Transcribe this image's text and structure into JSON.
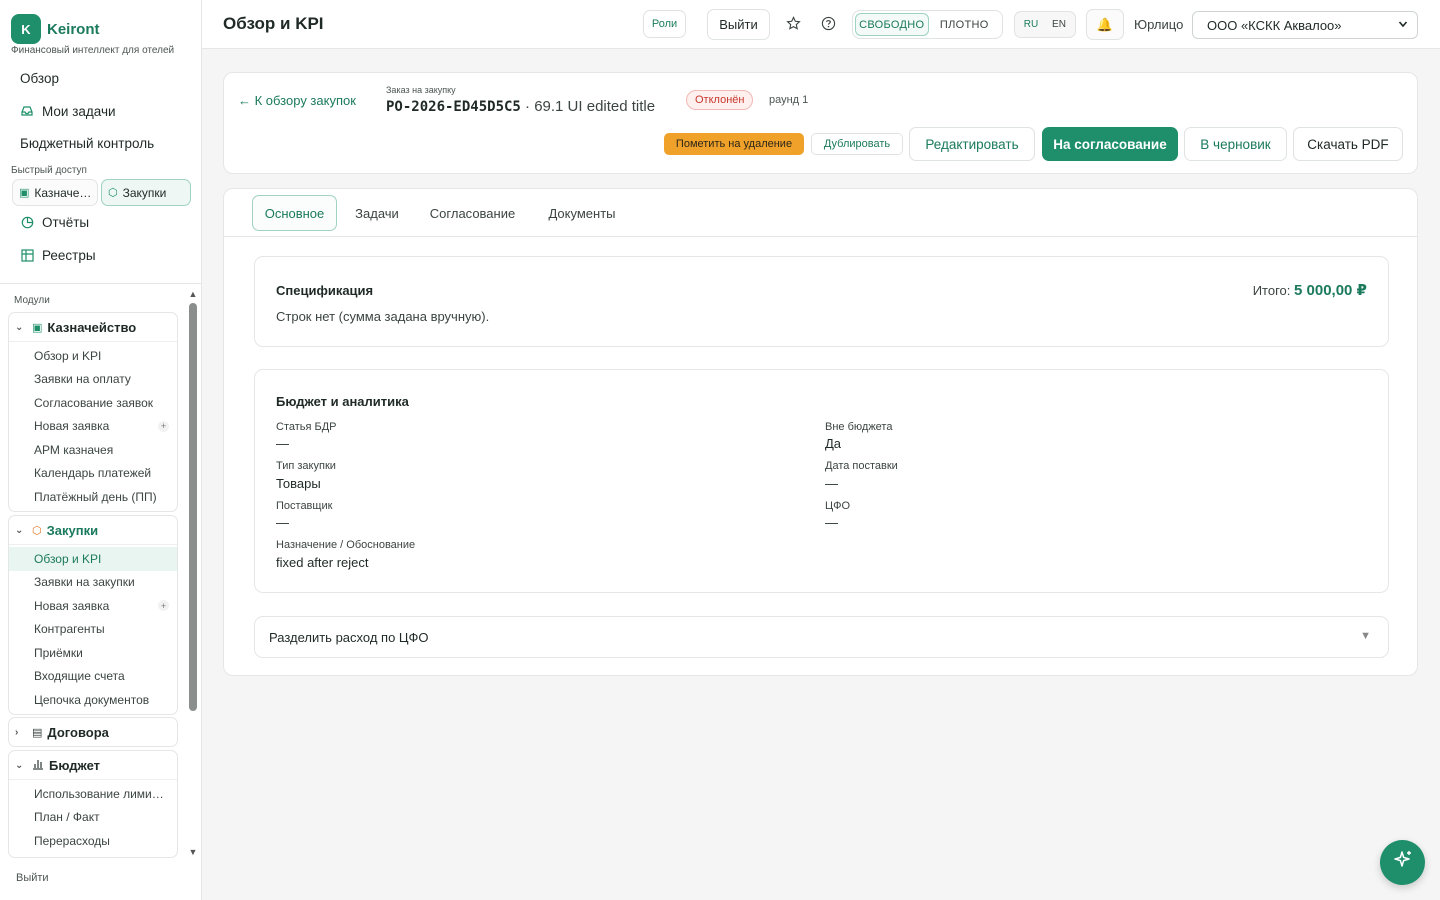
{
  "brand": {
    "logo_letter": "K",
    "name": "Keiront",
    "subtitle": "Финансовый интеллект для отелей"
  },
  "sidebar": {
    "top_items": [
      {
        "label": "Обзор",
        "icon": "none"
      },
      {
        "label": "Мои задачи",
        "icon": "inbox-icon"
      },
      {
        "label": "Бюджетный контроль",
        "icon": "none"
      }
    ],
    "quick_access_label": "Быстрый доступ",
    "quick_chips": [
      {
        "label": "Казначе…",
        "icon": "wallet-icon"
      },
      {
        "label": "Закупки",
        "icon": "box-icon"
      }
    ],
    "secondary_items": [
      {
        "label": "Отчёты",
        "icon": "pie-chart-icon"
      },
      {
        "label": "Реестры",
        "icon": "table-icon"
      }
    ],
    "modules_label": "Модули",
    "groups": [
      {
        "title": "Казначейство",
        "icon": "wallet-icon",
        "expanded": true,
        "items": [
          "Обзор и KPI",
          "Заявки на оплату",
          "Согласование заявок",
          "Новая заявка",
          "АРМ казначея",
          "Календарь платежей",
          "Платёжный день (ПП)"
        ]
      },
      {
        "title": "Закупки",
        "icon": "box-icon",
        "expanded": true,
        "active": true,
        "items": [
          "Обзор и KPI",
          "Заявки на закупки",
          "Новая заявка",
          "Контрагенты",
          "Приёмки",
          "Входящие счета",
          "Цепочка документов"
        ]
      },
      {
        "title": "Договора",
        "icon": "document-icon",
        "expanded": false
      },
      {
        "title": "Бюджет",
        "icon": "bar-chart-icon",
        "expanded": true,
        "items": [
          "Использование лими…",
          "План / Факт",
          "Перерасходы"
        ]
      }
    ],
    "plus_sign": "+",
    "logout_label": "Выйти"
  },
  "header": {
    "title": "Обзор и KPI",
    "roles_label": "Роли",
    "logout_label": "Выйти",
    "density_options": [
      "СВОБОДНО",
      "ПЛОТНО"
    ],
    "density_selected": "СВОБОДНО",
    "languages": [
      "RU",
      "EN"
    ],
    "language_selected": "RU",
    "entity_label": "Юрлицо",
    "entity_value": "ООО «КСКК Аквалоо»"
  },
  "order": {
    "back_link": "← К обзору закупок",
    "caption": "Заказ на закупку",
    "number": "PO-2026-ED45D5C5",
    "title_suffix": "· 69.1 UI edited title",
    "status": "Отклонён",
    "round": "раунд 1",
    "buttons": {
      "mark_delete": "Пометить на удаление",
      "duplicate": "Дублировать",
      "edit": "Редактировать",
      "submit": "На согласование",
      "to_draft": "В черновик",
      "download_pdf": "Скачать PDF"
    }
  },
  "tabs": [
    "Основное",
    "Задачи",
    "Согласование",
    "Документы"
  ],
  "active_tab": "Основное",
  "specification": {
    "title": "Спецификация",
    "empty_text": "Строк нет (сумма задана вручную).",
    "total_label": "Итого:",
    "total_value": "5 000,00 ₽"
  },
  "budget": {
    "title": "Бюджет и аналитика",
    "fields": {
      "bdr_article": {
        "label": "Статья БДР",
        "value": "—"
      },
      "off_budget": {
        "label": "Вне бюджета",
        "value": "Да"
      },
      "purchase_type": {
        "label": "Тип закупки",
        "value": "Товары"
      },
      "delivery_date": {
        "label": "Дата поставки",
        "value": "—"
      },
      "supplier": {
        "label": "Поставщик",
        "value": "—"
      },
      "cfo": {
        "label": "ЦФО",
        "value": "—"
      },
      "purpose": {
        "label": "Назначение / Обоснование",
        "value": "fixed after reject"
      }
    }
  },
  "split": {
    "title": "Разделить расход по ЦФО",
    "arrow": "▼"
  },
  "colors": {
    "brand": "#1e8f6a",
    "danger": "#c8372c",
    "warning": "#f0a12a"
  }
}
